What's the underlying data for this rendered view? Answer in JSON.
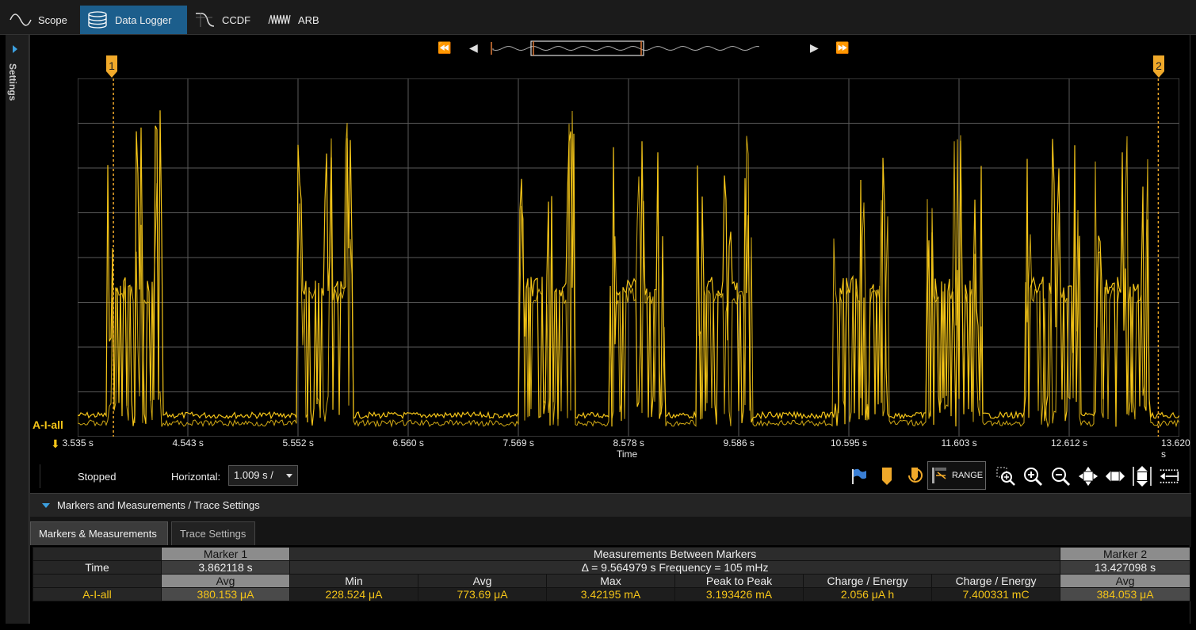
{
  "tabs": [
    {
      "label": "Scope",
      "icon": "sine-wave-icon"
    },
    {
      "label": "Data Logger",
      "icon": "database-icon"
    },
    {
      "label": "CCDF",
      "icon": "ccdf-curve-icon"
    },
    {
      "label": "ARB",
      "icon": "arb-waveform-icon"
    }
  ],
  "sidebar": {
    "label": "Settings"
  },
  "navigation": {
    "first": "⏪",
    "prev": "◀",
    "next": "▶",
    "last": "⏩"
  },
  "chart_data": {
    "type": "line",
    "xlabel": "Time",
    "x_tick_labels": [
      "3.535 s",
      "4.543 s",
      "5.552 s",
      "6.560 s",
      "7.569 s",
      "8.578 s",
      "9.586 s",
      "10.595 s",
      "11.603 s",
      "12.612 s",
      "13.620 s"
    ],
    "xlim": [
      3.535,
      13.62
    ],
    "grid": true,
    "trace_name": "A-I-all",
    "trace_color": "#f5c518",
    "markers": [
      {
        "label": "1",
        "time_s": 3.862118
      },
      {
        "label": "2",
        "time_s": 13.427098
      }
    ],
    "bursts_start_s": [
      3.8,
      5.55,
      7.58,
      8.4,
      9.2,
      10.45,
      11.3,
      12.2,
      12.85
    ]
  },
  "status": {
    "state": "Stopped",
    "horizontal_label": "Horizontal:",
    "horizontal_value": "1.009 s /"
  },
  "toolbar": {
    "range_label": "RANGE",
    "icons": [
      "flag-icon",
      "marker-icon",
      "marker-reset-icon",
      "range-icon",
      "zoom-box-icon",
      "zoom-in-icon",
      "zoom-out-icon",
      "fit-all-icon",
      "fit-horizontal-icon",
      "fit-vertical-icon",
      "horizontal-scale-icon"
    ]
  },
  "section": {
    "title": "Markers and Measurements / Trace Settings"
  },
  "subtabs": [
    {
      "label": "Markers & Measurements"
    },
    {
      "label": "Trace Settings"
    }
  ],
  "table": {
    "marker1_title": "Marker 1",
    "between_title": "Measurements Between Markers",
    "marker2_title": "Marker 2",
    "time_label": "Time",
    "marker1_time": "3.862118 s",
    "between_time": "Δ = 9.564979 s   Frequency = 105 mHz",
    "marker2_time": "13.427098 s",
    "columns": [
      "Avg",
      "Min",
      "Avg",
      "Max",
      "Peak to Peak",
      "Charge / Energy",
      "Charge / Energy",
      "Avg"
    ],
    "row_label": "A-I-all",
    "values": [
      "380.153 μA",
      "228.524 μA",
      "773.69 μA",
      "3.42195 mA",
      "3.193426 mA",
      "2.056 μA h",
      "7.400331 mC",
      "384.053 μA"
    ]
  }
}
